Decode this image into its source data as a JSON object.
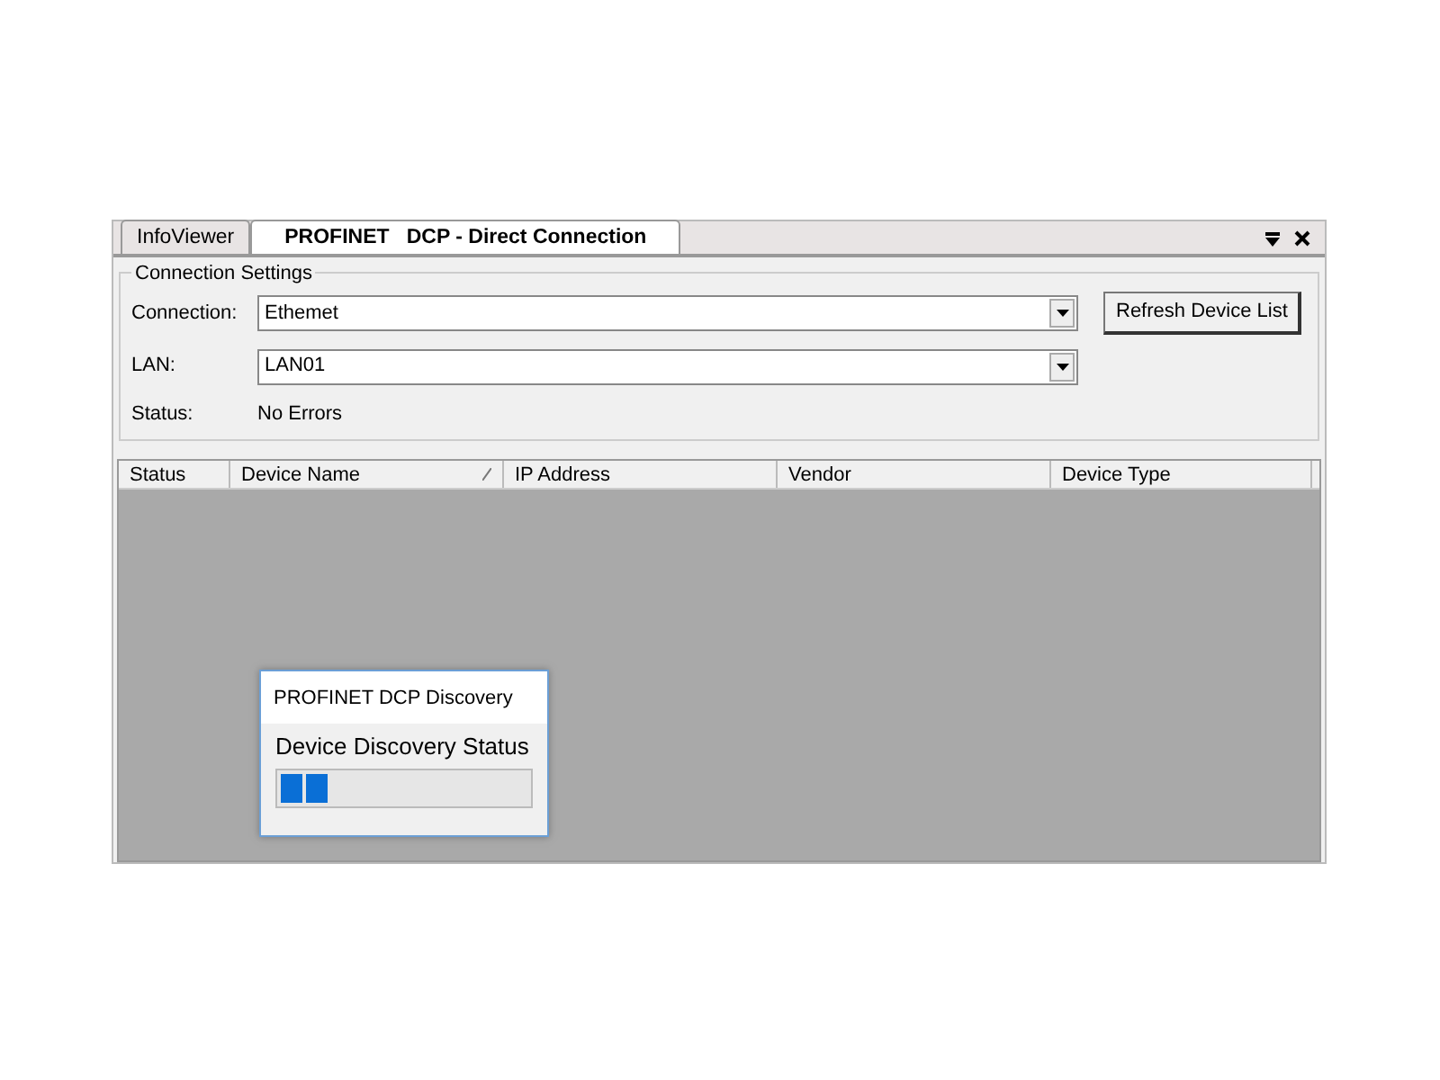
{
  "tabs": [
    {
      "label": "InfoViewer",
      "selected": false
    },
    {
      "label": "PROFINET   DCP - Direct Connection",
      "selected": true
    }
  ],
  "connection_settings": {
    "title": "Connection Settings",
    "fields": [
      {
        "label": "Connection:",
        "value": "Ethemet"
      },
      {
        "label": "LAN:",
        "value": "LAN01"
      }
    ],
    "status": {
      "label": "Status:",
      "value": "No Errors"
    },
    "refresh_button": "Refresh Device List"
  },
  "table": {
    "columns": [
      {
        "label": "Status",
        "sorted": false
      },
      {
        "label": "Device Name",
        "sorted": true
      },
      {
        "label": "IP Address",
        "sorted": false
      },
      {
        "label": "Vendor",
        "sorted": false
      },
      {
        "label": "Device Type",
        "sorted": false
      }
    ]
  },
  "dialog": {
    "title": "PROFINET DCP Discovery",
    "heading": "Device Discovery Status",
    "level": 0.2
  }
}
